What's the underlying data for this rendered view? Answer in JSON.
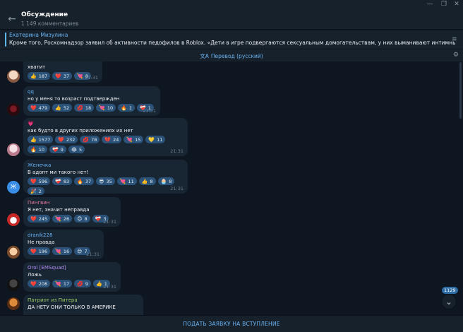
{
  "header": {
    "title": "Обсуждение",
    "subtitle": "1 149 комментариев"
  },
  "pinned": {
    "author": "Екатерина Мизулина",
    "text": "Кроме того, Роскомнадзор заявил об активности педофилов в Roblox.  «Дети в игре подвергаются сексуальным домогательствам, у них выманивают интимные фото, склоняют к развра..."
  },
  "translation": {
    "label": "Перевод (русский)"
  },
  "messages": [
    {
      "author": "",
      "text": "хватит",
      "time": "21:31",
      "reactions": [
        {
          "emoji": "👍",
          "count": "187"
        },
        {
          "emoji": "❤️",
          "count": "37"
        },
        {
          "emoji": "💘",
          "count": "8"
        }
      ]
    },
    {
      "author": "qq",
      "author_color": "#6ab3f3",
      "text": "но у меня то возраст подтвержден",
      "time": "21:31",
      "reactions": [
        {
          "emoji": "❤️",
          "count": "479"
        },
        {
          "emoji": "👍",
          "count": "52"
        },
        {
          "emoji": "💋",
          "count": "18"
        },
        {
          "emoji": "💘",
          "count": "10"
        },
        {
          "emoji": "🔥",
          "count": "1"
        },
        {
          "emoji": "❤️‍🩹",
          "count": "1"
        }
      ]
    },
    {
      "author": "",
      "prefix_emoji": "💗",
      "text": "как будто в других приложениях их нет",
      "time": "21:31",
      "reactions": [
        {
          "emoji": "👍",
          "count": "1577"
        },
        {
          "emoji": "❤️",
          "count": "232"
        },
        {
          "emoji": "💋",
          "count": "78"
        },
        {
          "emoji": "💔",
          "count": "24"
        },
        {
          "emoji": "💘",
          "count": "15"
        },
        {
          "emoji": "💛",
          "count": "11"
        },
        {
          "emoji": "🔥",
          "count": "10"
        },
        {
          "emoji": "❤️‍🩹",
          "count": "9"
        },
        {
          "emoji": "😂",
          "count": "5"
        }
      ]
    },
    {
      "author": "Женечка",
      "author_color": "#6ab3f3",
      "text": "В адопт ми такого нет!",
      "time": "21:31",
      "reactions": [
        {
          "emoji": "❤️",
          "count": "596"
        },
        {
          "emoji": "❤️‍🩹",
          "count": "83"
        },
        {
          "emoji": "🔥",
          "count": "37"
        },
        {
          "emoji": "😎",
          "count": "35"
        },
        {
          "emoji": "💘",
          "count": "11"
        },
        {
          "emoji": "👍",
          "count": "8"
        },
        {
          "emoji": "🧁",
          "count": "8"
        },
        {
          "emoji": "🎉",
          "count": "2"
        }
      ]
    },
    {
      "author": "Пингвин",
      "author_color": "#e27a98",
      "text": "Я нет, значит неправда",
      "time": "21:31",
      "reactions": [
        {
          "emoji": "❤️",
          "count": "245"
        },
        {
          "emoji": "💘",
          "count": "26"
        },
        {
          "emoji": "😍",
          "count": "8"
        },
        {
          "emoji": "❤️‍🩹",
          "count": "3"
        }
      ]
    },
    {
      "author": "dranik228",
      "author_color": "#6ab3f3",
      "text": "Не правда",
      "time": "21:31",
      "reactions": [
        {
          "emoji": "❤️",
          "count": "196"
        },
        {
          "emoji": "💘",
          "count": "16"
        },
        {
          "emoji": "😍",
          "count": "7"
        }
      ]
    },
    {
      "author": "Orol [EMSquad]",
      "author_color": "#b18cf3",
      "text": "Ложь",
      "time": "21:31",
      "reactions": [
        {
          "emoji": "❤️",
          "count": "208"
        },
        {
          "emoji": "💘",
          "count": "17"
        },
        {
          "emoji": "💋",
          "count": "9"
        },
        {
          "emoji": "👍",
          "count": "1"
        }
      ]
    },
    {
      "author": "Патриот из Питера",
      "author_color": "#9ccc65",
      "text": "ДА НЕТУ ОНИ ТОЛЬКО В АМЕРИКЕ",
      "time": "",
      "reactions": []
    }
  ],
  "avatar_letters": {
    "zhenechka": "Ж"
  },
  "scroll": {
    "unread": "1129"
  },
  "bottom": {
    "join_label": "ПОДАТЬ ЗАЯВКУ НА ВСТУПЛЕНИЕ"
  },
  "colors": {
    "background": "#0e1621",
    "panel": "#17212b",
    "bubble": "#182533",
    "reaction": "#2b5278",
    "accent": "#6ab3f3"
  }
}
